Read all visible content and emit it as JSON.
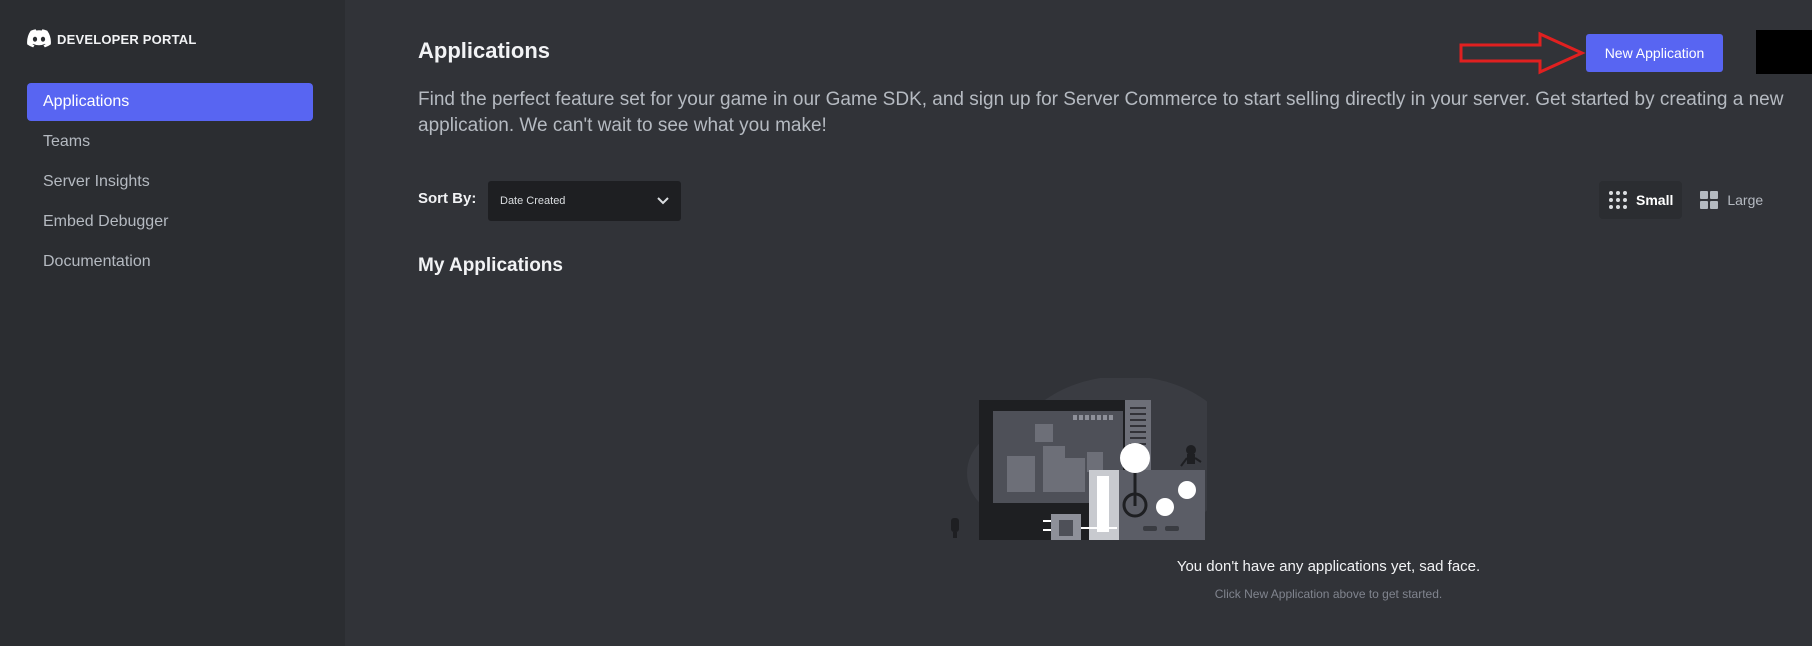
{
  "sidebar": {
    "brand": "DEVELOPER PORTAL",
    "items": [
      {
        "label": "Applications",
        "active": true
      },
      {
        "label": "Teams"
      },
      {
        "label": "Server Insights"
      },
      {
        "label": "Embed Debugger"
      },
      {
        "label": "Documentation"
      }
    ]
  },
  "header": {
    "title": "Applications",
    "new_button": "New Application",
    "description": "Find the perfect feature set for your game in our Game SDK, and sign up for Server Commerce to start selling directly in your server. Get started by creating a new application. We can't wait to see what you make!"
  },
  "sort": {
    "label": "Sort By:",
    "selected": "Date Created"
  },
  "view_size": {
    "small": "Small",
    "large": "Large",
    "selected": "Small"
  },
  "my_apps": {
    "title": "My Applications",
    "empty_title": "You don't have any applications yet, sad face.",
    "empty_subtitle": "Click New Application above to get started."
  },
  "colors": {
    "accent": "#5865f2",
    "sidebar_bg": "#2b2d31",
    "main_bg": "#313338",
    "annotation_arrow": "#e02020"
  },
  "icons": [
    "discord-logo-icon",
    "chevron-down-icon",
    "grid-small-icon",
    "grid-large-icon",
    "annotation-arrow-icon"
  ]
}
